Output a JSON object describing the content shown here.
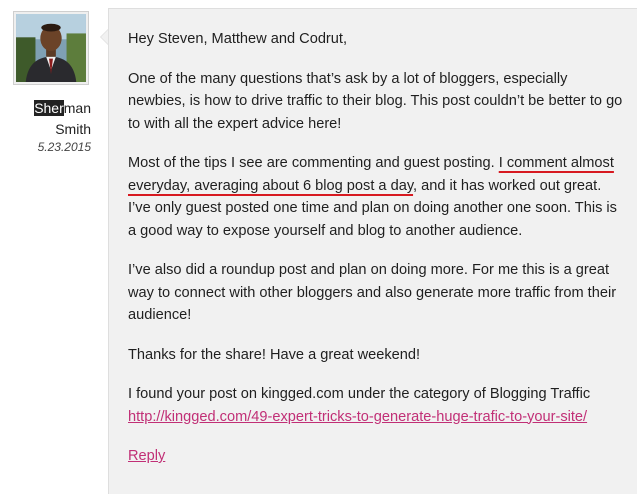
{
  "author": {
    "name_selected": "Sher",
    "name_rest": "man",
    "surname": "Smith",
    "date": "5.23.2015"
  },
  "comment": {
    "greeting": "Hey Steven, Matthew and Codrut,",
    "p1": "One of the many questions that’s ask by a lot of bloggers, especially newbies, is how to drive traffic to their blog. This post couldn’t be better to go to with all the expert advice here!",
    "p2_before": "Most of the tips I see are commenting and guest posting. ",
    "p2_highlight": "I comment almost everyday, averaging about 6 blog post a day",
    "p2_after": ", and it has worked out great. I’ve only guest posted one time and plan on doing another one soon. This is a good way to expose yourself and blog to another audience.",
    "p3": "I’ve also did a roundup post and plan on doing more. For me this is a great way to connect with other bloggers and also generate more traffic from their audience!",
    "p4": "Thanks for the share! Have a great weekend!",
    "p5_text": "I found your post on kingged.com under the category of Blogging Traffic",
    "p5_link": "http://kingged.com/49-expert-tricks-to-generate-huge-trafic-to-your-site/",
    "reply_label": "Reply"
  }
}
